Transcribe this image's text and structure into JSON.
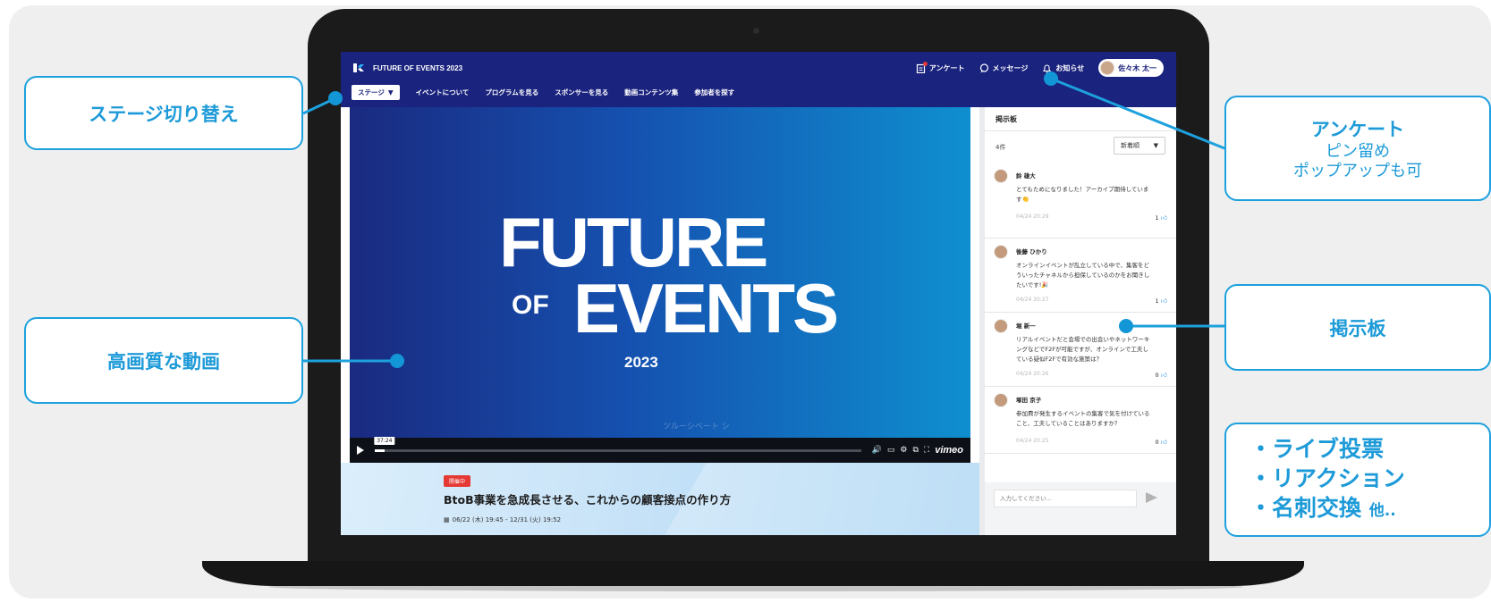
{
  "header": {
    "brand": "FUTURE OF EVENTS 2023",
    "survey": "アンケート",
    "messages": "メッセージ",
    "notifications": "お知らせ",
    "user_name": "佐々木 太一"
  },
  "nav": {
    "stage": "ステージ",
    "items": [
      "イベントについて",
      "プログラムを見る",
      "スポンサーを見る",
      "動画コンテンツ集",
      "参加者を探す"
    ]
  },
  "video": {
    "title_line1": "FUTURE",
    "title_of": "OF",
    "title_line2": "EVENTS",
    "year": "2023",
    "ghost_caption": "ツルーシベート シ",
    "time_tooltip": "37:24",
    "progress": 0.02,
    "player_brand": "vimeo"
  },
  "session": {
    "status_badge": "開催中",
    "title": "BtoB事業を急成長させる、これからの顧客接点の作り方",
    "date": "06/22 (木) 19:45 - 12/31 (火) 19:52"
  },
  "board": {
    "title": "掲示板",
    "count": "4件",
    "sort": "新着順",
    "input_placeholder": "入力してください...",
    "posts": [
      {
        "name": "鈴 雄大",
        "body": "とてもためになりました！アーカイブ期待していま す👏",
        "time": "04/24 20:29",
        "likes": "1"
      },
      {
        "name": "後藤 ひかり",
        "body": "オンラインイベントが乱立している中で、集客をど ういったチャネルから担保しているのかをお聞きし たいです!🎉",
        "time": "04/24 20:27",
        "likes": "1"
      },
      {
        "name": "堀 新一",
        "body": "リアルイベントだと会場での出会いやネットワーキ ングなどでF2Fが可能ですが、オンラインで工夫し ている疑似F2Fで有効な施策は？",
        "time": "04/24 20:26",
        "likes": "0"
      },
      {
        "name": "塚田 京子",
        "body": "参加費が発生するイベントの集客で気を付けている こと、工夫していることはありますか？",
        "time": "04/24 20:25",
        "likes": "0"
      }
    ]
  },
  "callouts": {
    "stage": "ステージ切り替え",
    "video": "高画質な動画",
    "survey_title": "アンケート",
    "survey_line1": "ピン留め",
    "survey_line2": "ポップアップも可",
    "board": "掲示板",
    "feature1": "・ライブ投票",
    "feature2": "・リアクション",
    "feature3": "・名刺交換",
    "feature3_suffix": "他.."
  },
  "colors": {
    "header_bg": "#1a237e",
    "accent": "#1da1dd",
    "live_badge": "#e53935"
  }
}
